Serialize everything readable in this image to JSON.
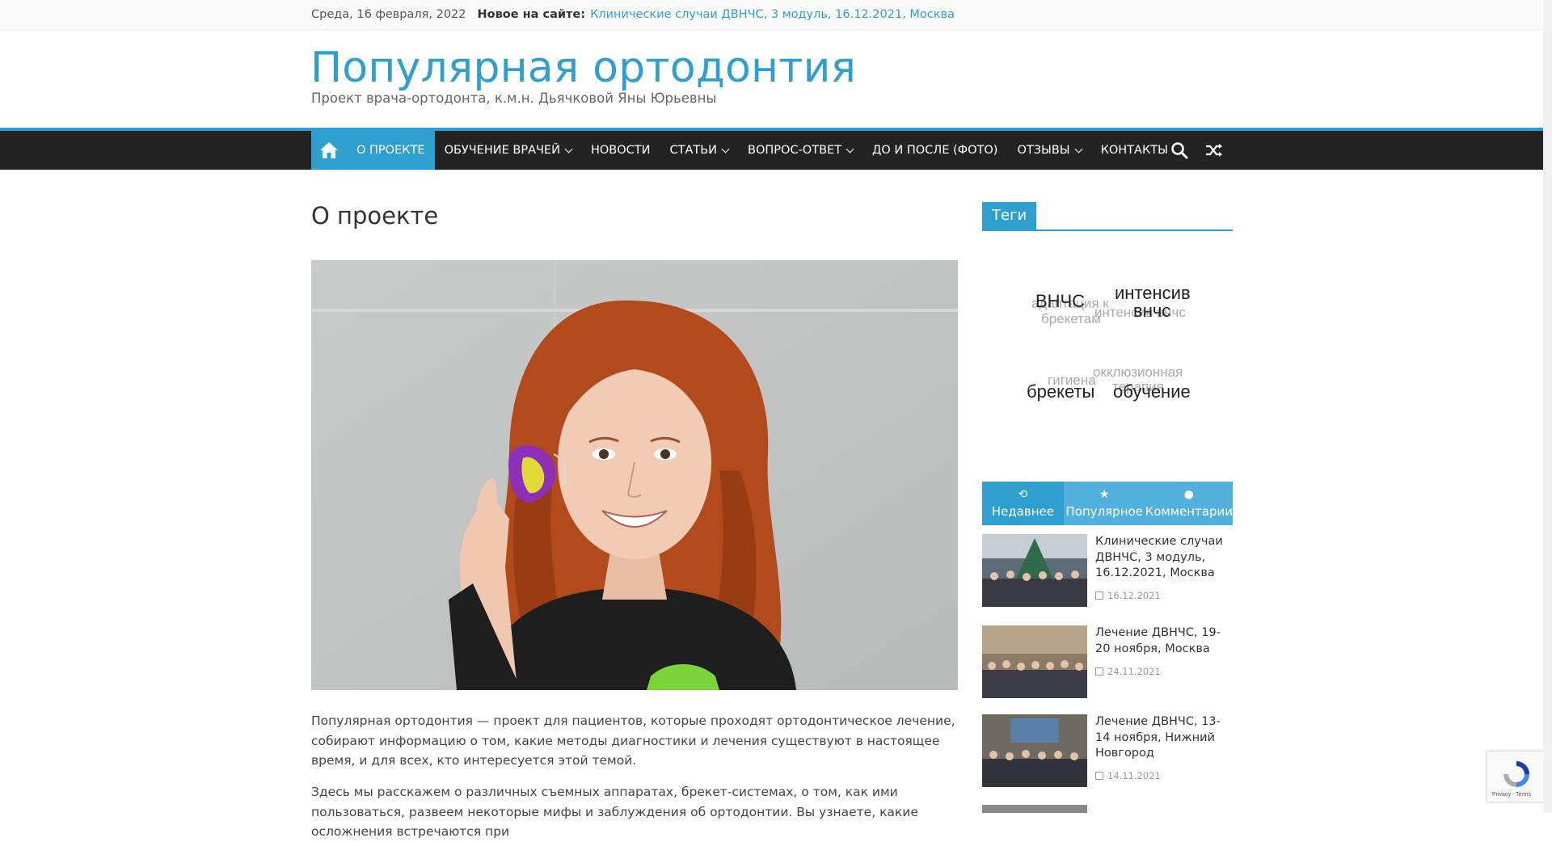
{
  "topbar": {
    "date": "Среда, 16 февраля, 2022",
    "new_label": "Новое на сайте:",
    "new_link": "Клинические случаи ДВНЧС, 3 модуль, 16.12.2021, Москва"
  },
  "site": {
    "title": "Популярная ортодонтия",
    "description": "Проект врача-ортодонта, к.м.н. Дьячковой Яны Юрьевны"
  },
  "nav": {
    "home_icon": "home-icon",
    "items": [
      {
        "label": "О ПРОЕКТЕ",
        "active": true,
        "dropdown": false
      },
      {
        "label": "ОБУЧЕНИЕ ВРАЧЕЙ",
        "active": false,
        "dropdown": true
      },
      {
        "label": "НОВОСТИ",
        "active": false,
        "dropdown": false
      },
      {
        "label": "СТАТЬИ",
        "active": false,
        "dropdown": true
      },
      {
        "label": "ВОПРОС-ОТВЕТ",
        "active": false,
        "dropdown": true
      },
      {
        "label": "ДО И ПОСЛЕ (ФОТО)",
        "active": false,
        "dropdown": false
      },
      {
        "label": "ОТЗЫВЫ",
        "active": false,
        "dropdown": true
      },
      {
        "label": "КОНТАКТЫ",
        "active": false,
        "dropdown": false
      }
    ]
  },
  "page": {
    "title": "О проекте",
    "para1": "Популярная ортодонтия — проект для пациентов, которые проходят ортодонтическое лечение, собирают информацию о том, какие методы диагностики и лечения существуют в настоящее время, и для всех, кто интересуется этой темой.",
    "para2": "Здесь мы расскажем о различных съемных аппаратах, брекет-системах, о том, как ими пользоваться, развеем некоторые мифы и заблуждения об ортодонтии. Вы узнаете, какие осложнения встречаются при"
  },
  "sidebar": {
    "tags_title": "Теги",
    "tags": {
      "t1": "ВНЧС",
      "t2": "адаптация к",
      "t3": "брекетам",
      "t4": "интенсив",
      "t5": "интенсив внчс",
      "t6": "внчс",
      "t7": "окклюзионная",
      "t8": "терапия",
      "t9": "гигиена",
      "t10": "брекеты",
      "t11": "обучение"
    },
    "tabs": [
      {
        "label": "Недавнее",
        "icon": "history-icon",
        "active": true
      },
      {
        "label": "Популярное",
        "icon": "star-icon",
        "active": false
      },
      {
        "label": "Комментарии",
        "icon": "comment-icon",
        "active": false
      }
    ],
    "posts": [
      {
        "title": "Клинические случаи ДВНЧС, 3 модуль, 16.12.2021, Москва",
        "date": "16.12.2021"
      },
      {
        "title": "Лечение ДВНЧС, 19-20 ноября, Москва",
        "date": "24.11.2021"
      },
      {
        "title": "Лечение ДВНЧС, 13-14 ноября, Нижний Новгород",
        "date": "14.11.2021"
      }
    ]
  },
  "recaptcha": {
    "footer": "Privacy - Terms"
  },
  "colors": {
    "accent": "#2f9fd0",
    "nav_bg": "#232323"
  }
}
